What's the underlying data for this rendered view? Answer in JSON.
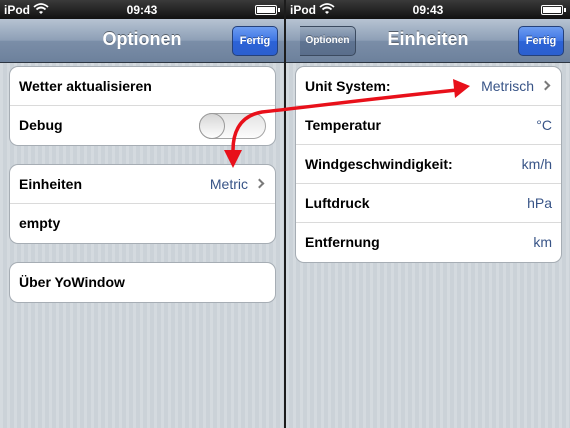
{
  "left": {
    "status": {
      "carrier": "iPod",
      "time": "09:43"
    },
    "nav": {
      "title": "Optionen",
      "done_label": "Fertig"
    },
    "groups": {
      "general": {
        "refresh_label": "Wetter aktualisieren",
        "debug_label": "Debug",
        "debug_on": false
      },
      "units": {
        "units_label": "Einheiten",
        "units_value": "Metric",
        "empty_label": "empty"
      },
      "about": {
        "about_label": "Über YoWindow"
      }
    }
  },
  "right": {
    "status": {
      "carrier": "iPod",
      "time": "09:43"
    },
    "nav": {
      "title": "Einheiten",
      "back_label": "Optionen",
      "done_label": "Fertig"
    },
    "rows": [
      {
        "label": "Unit System:",
        "value": "Metrisch"
      },
      {
        "label": "Temperatur",
        "value": "°C"
      },
      {
        "label": "Windgeschwindigkeit:",
        "value": "km/h"
      },
      {
        "label": "Luftdruck",
        "value": "hPa"
      },
      {
        "label": "Entfernung",
        "value": "km"
      }
    ]
  },
  "colors": {
    "accent_blue": "#3d74e4",
    "value_text": "#385487",
    "annotation_arrow": "#e8101a",
    "background": "#cbd2d8"
  },
  "icons": {
    "wifi": "wifi-icon",
    "battery": "battery-icon",
    "chevron": "chevron-right-icon",
    "arrow": "annotation-arrow"
  }
}
